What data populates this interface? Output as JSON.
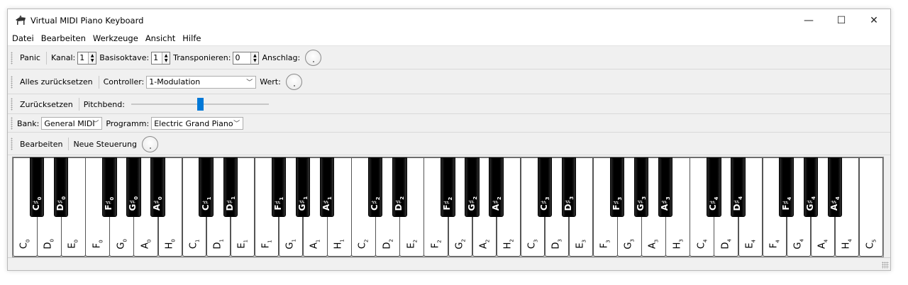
{
  "window": {
    "title": "Virtual MIDI Piano Keyboard",
    "app_icon": "grand-piano-icon",
    "minimize": "—",
    "maximize": "☐",
    "close": "✕"
  },
  "menu": [
    "Datei",
    "Bearbeiten",
    "Werkzeuge",
    "Ansicht",
    "Hilfe"
  ],
  "toolbar1": {
    "panic": "Panic",
    "channel_label": "Kanal:",
    "channel_value": "1",
    "octave_label": "Basisoktave:",
    "octave_value": "1",
    "transpose_label": "Transponieren:",
    "transpose_value": "0",
    "velocity_label": "Anschlag:"
  },
  "toolbar2": {
    "reset_all": "Alles zurücksetzen",
    "controller_label": "Controller:",
    "controller_value": "1-Modulation",
    "value_label": "Wert:"
  },
  "toolbar3": {
    "reset": "Zurücksetzen",
    "pitchbend_label": "Pitchbend:",
    "pitchbend_level": 0.5
  },
  "toolbar4": {
    "bank_label": "Bank:",
    "bank_value": "General MIDI",
    "program_label": "Programm:",
    "program_value": "Electric Grand Piano"
  },
  "toolbar5": {
    "edit": "Bearbeiten",
    "new_control": "Neue Steuerung"
  },
  "piano": {
    "white_keys": [
      {
        "n": "C",
        "o": "0"
      },
      {
        "n": "D",
        "o": "0"
      },
      {
        "n": "E",
        "o": "0"
      },
      {
        "n": "F",
        "o": "0"
      },
      {
        "n": "G",
        "o": "0"
      },
      {
        "n": "A",
        "o": "0"
      },
      {
        "n": "H",
        "o": "0"
      },
      {
        "n": "C",
        "o": "1"
      },
      {
        "n": "D",
        "o": "1"
      },
      {
        "n": "E",
        "o": "1"
      },
      {
        "n": "F",
        "o": "1"
      },
      {
        "n": "G",
        "o": "1"
      },
      {
        "n": "A",
        "o": "1"
      },
      {
        "n": "H",
        "o": "1"
      },
      {
        "n": "C",
        "o": "2"
      },
      {
        "n": "D",
        "o": "2"
      },
      {
        "n": "E",
        "o": "2"
      },
      {
        "n": "F",
        "o": "2"
      },
      {
        "n": "G",
        "o": "2"
      },
      {
        "n": "A",
        "o": "2"
      },
      {
        "n": "H",
        "o": "2"
      },
      {
        "n": "C",
        "o": "3"
      },
      {
        "n": "D",
        "o": "3"
      },
      {
        "n": "E",
        "o": "3"
      },
      {
        "n": "F",
        "o": "3"
      },
      {
        "n": "G",
        "o": "3"
      },
      {
        "n": "A",
        "o": "3"
      },
      {
        "n": "H",
        "o": "3"
      },
      {
        "n": "C",
        "o": "4"
      },
      {
        "n": "D",
        "o": "4"
      },
      {
        "n": "E",
        "o": "4"
      },
      {
        "n": "F",
        "o": "4"
      },
      {
        "n": "G",
        "o": "4"
      },
      {
        "n": "A",
        "o": "4"
      },
      {
        "n": "H",
        "o": "4"
      },
      {
        "n": "C",
        "o": "5"
      }
    ],
    "black_keys": [
      {
        "n": "C♯",
        "o": "0"
      },
      {
        "n": "D♯",
        "o": "0"
      },
      {
        "n": "F♯",
        "o": "0"
      },
      {
        "n": "G♯",
        "o": "0"
      },
      {
        "n": "A♯",
        "o": "0"
      },
      {
        "n": "C♯",
        "o": "1"
      },
      {
        "n": "D♯",
        "o": "1"
      },
      {
        "n": "F♯",
        "o": "1"
      },
      {
        "n": "G♯",
        "o": "1"
      },
      {
        "n": "A♯",
        "o": "1"
      },
      {
        "n": "C♯",
        "o": "2"
      },
      {
        "n": "D♯",
        "o": "2"
      },
      {
        "n": "F♯",
        "o": "2"
      },
      {
        "n": "G♯",
        "o": "2"
      },
      {
        "n": "A♯",
        "o": "2"
      },
      {
        "n": "C♯",
        "o": "3"
      },
      {
        "n": "D♯",
        "o": "3"
      },
      {
        "n": "F♯",
        "o": "3"
      },
      {
        "n": "G♯",
        "o": "3"
      },
      {
        "n": "A♯",
        "o": "3"
      },
      {
        "n": "C♯",
        "o": "4"
      },
      {
        "n": "D♯",
        "o": "4"
      },
      {
        "n": "F♯",
        "o": "4"
      },
      {
        "n": "G♯",
        "o": "4"
      },
      {
        "n": "A♯",
        "o": "4"
      }
    ]
  }
}
